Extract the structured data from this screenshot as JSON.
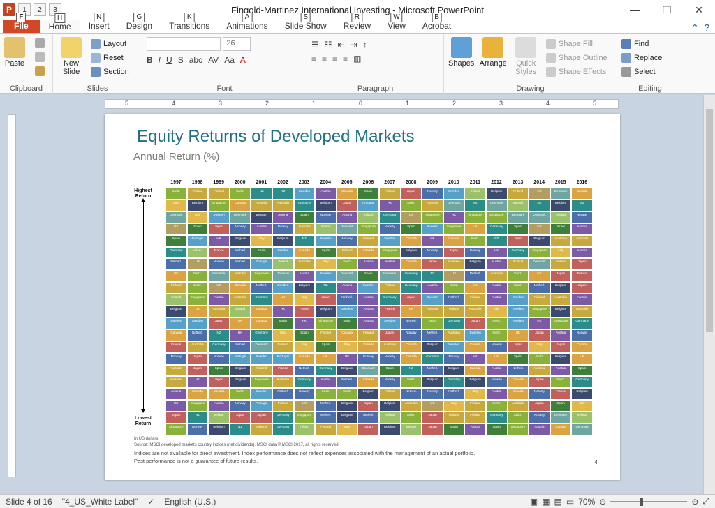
{
  "window": {
    "title": "Fingold-Martinez International Investing  -  Microsoft PowerPoint",
    "app_icon": "P",
    "qat": [
      "1",
      "2",
      "3"
    ]
  },
  "tabs": [
    {
      "label": "File",
      "key": "F"
    },
    {
      "label": "Home",
      "key": "H"
    },
    {
      "label": "Insert",
      "key": "N"
    },
    {
      "label": "Design",
      "key": "G"
    },
    {
      "label": "Transitions",
      "key": "K"
    },
    {
      "label": "Animations",
      "key": "A"
    },
    {
      "label": "Slide Show",
      "key": "S"
    },
    {
      "label": "Review",
      "key": "R"
    },
    {
      "label": "View",
      "key": "W"
    },
    {
      "label": "Acrobat",
      "key": "B"
    }
  ],
  "ribbon": {
    "clipboard": {
      "label": "Clipboard",
      "paste": "Paste"
    },
    "slides": {
      "label": "Slides",
      "new_slide": "New Slide",
      "layout": "Layout",
      "reset": "Reset",
      "section": "Section"
    },
    "font": {
      "label": "Font",
      "size": "26"
    },
    "paragraph": {
      "label": "Paragraph"
    },
    "drawing": {
      "label": "Drawing",
      "shapes": "Shapes",
      "arrange": "Arrange",
      "quick_styles": "Quick Styles",
      "shape_fill": "Shape Fill",
      "shape_outline": "Shape Outline",
      "shape_effects": "Shape Effects"
    },
    "editing": {
      "label": "Editing",
      "find": "Find",
      "replace": "Replace",
      "select": "Select"
    }
  },
  "ruler_labels": [
    "5",
    "4",
    "3",
    "2",
    "1",
    "0",
    "1",
    "2",
    "3",
    "4",
    "5"
  ],
  "slide": {
    "title": "Equity Returns of Developed Markets",
    "subtitle": "Annual Return (%)",
    "highest": "Highest Return",
    "lowest": "Lowest Return",
    "years": [
      "1997",
      "1998",
      "1999",
      "2000",
      "2001",
      "2002",
      "2003",
      "2004",
      "2005",
      "2006",
      "2007",
      "2008",
      "2009",
      "2010",
      "2011",
      "2012",
      "2013",
      "2014",
      "2015",
      "2016"
    ],
    "foot1": "In US dollars.",
    "foot2": "Source: MSCI developed markets country indices (net dividends). MSCI data © MSCI 2017, all rights reserved.",
    "foot3": "Indices are not available for direct investment. Index performance does not reflect expenses associated with the management of an actual portfolio.",
    "foot4": "Past performance is not a guarantee of future results.",
    "page": "4",
    "grid_rows": [
      [
        "Switz.",
        "Finland",
        "Finland",
        "Switz.",
        "NZ",
        "NZ",
        "Sweden",
        "Austria",
        "Canada",
        "Spain",
        "Finland",
        "Japan",
        "Norway",
        "Sweden",
        "Ireland",
        "Belgium",
        "Finland",
        "US",
        "Denmark",
        "Canada"
      ],
      [
        "Italy",
        "Belgium",
        "Singapore",
        "Canada",
        "Australia",
        "Australia",
        "Germany",
        "Belgium",
        "Japan",
        "Portugal",
        "HK",
        "Switz.",
        "Australia",
        "Denmark",
        "NZ",
        "Denmark",
        "Ireland",
        "NZ",
        "Belgium",
        "NZ"
      ],
      [
        "Denmark",
        "Italy",
        "Sweden",
        "Denmark",
        "Belgium",
        "Austria",
        "Spain",
        "Norway",
        "Austria",
        "Ireland",
        "Germany",
        "US",
        "Singapore",
        "HK",
        "Singapore",
        "Singapore",
        "Denmark",
        "Denmark",
        "Ireland",
        "Norway"
      ],
      [
        "US",
        "Spain",
        "Japan",
        "Norway",
        "Austria",
        "Norway",
        "Australia",
        "Ireland",
        "Denmark",
        "Singapore",
        "Norway",
        "Spain",
        "Sweden",
        "Singapore",
        "UK",
        "Germany",
        "Spain",
        "US",
        "Israel",
        "Austria"
      ],
      [
        "Spain",
        "Portugal",
        "HK",
        "Belgium",
        "Italy",
        "Belgium",
        "NZ",
        "Sweden",
        "Norway",
        "Finland",
        "Sweden",
        "Canada",
        "HK",
        "Canada",
        "Switz.",
        "NZ",
        "Japan",
        "Belgium",
        "Australia",
        "Australia"
      ],
      [
        "Germany",
        "Ireland",
        "France",
        "Netherl.",
        "Spain",
        "Sweden",
        "Canada",
        "Spain",
        "Finland",
        "Canada",
        "Singapore",
        "Belgium",
        "Norway",
        "Japan",
        "Norway",
        "HK",
        "Germany",
        "Singapore",
        "Italy",
        "Austria"
      ],
      [
        "Netherl.",
        "US",
        "Norway",
        "Netherl.",
        "Portugal",
        "Ireland",
        "Australia",
        "Italy",
        "Switz.",
        "Austria",
        "Austria",
        "Canada",
        "Japan",
        "Australia",
        "Belgium",
        "Austria",
        "Finland",
        "Denmark",
        "Finland",
        "Japan"
      ],
      [
        "UK",
        "Switz.",
        "Denmark",
        "Australia",
        "Singapore",
        "Denmark",
        "Austria",
        "Sweden",
        "Denmark",
        "Spain",
        "Denmark",
        "Germany",
        "NZ",
        "US",
        "Netherl.",
        "Australia",
        "Switz.",
        "UK",
        "Japan",
        "France"
      ],
      [
        "Finland",
        "Switz.",
        "US",
        "Canada",
        "Netherl.",
        "Sweden",
        "Belgium",
        "NZ",
        "Austria",
        "Sweden",
        "Finland",
        "Germany",
        "Austria",
        "Switz.",
        "UK",
        "Austria",
        "Switz.",
        "Netherl.",
        "Belgium",
        "Japan"
      ],
      [
        "Ireland",
        "Singapore",
        "Austria",
        "Australia",
        "Germany",
        "UK",
        "Italy",
        "Japan",
        "Netherl.",
        "Austria",
        "Germany",
        "Japan",
        "Sweden",
        "Netherl.",
        "Finland",
        "Austria",
        "Sweden",
        "Finland",
        "Australia",
        "Austria"
      ],
      [
        "Belgium",
        "UK",
        "Australia",
        "Ireland",
        "Canada",
        "HK",
        "France",
        "Belgium",
        "Sweden",
        "Austria",
        "France",
        "UK",
        "Australia",
        "Finland",
        "Australia",
        "Italy",
        "Sweden",
        "Singapore",
        "Belgium",
        "Australia"
      ],
      [
        "Sweden",
        "Sweden",
        "Japan",
        "UK",
        "Canada",
        "Spain",
        "HK",
        "Singapore",
        "Spain",
        "Austria",
        "Sweden",
        "Netherl.",
        "Switz.",
        "Germany",
        "Japan",
        "Switz.",
        "Sweden",
        "HK",
        "Singapore",
        "Germany"
      ],
      [
        "Canada",
        "Netherl.",
        "NZ",
        "HK",
        "Germany",
        "Italy",
        "Spain",
        "Finland",
        "Canada",
        "Finland",
        "Japan",
        "Norway",
        "Netherl.",
        "Australia",
        "Sweden",
        "Switz.",
        "UK",
        "Japan",
        "Austria",
        "Norway"
      ],
      [
        "France",
        "Australia",
        "Germany",
        "Netherl.",
        "Denmark",
        "Finland",
        "Italy",
        "Spain",
        "Italy",
        "Canada",
        "Australia",
        "Canada",
        "Belgium",
        "Sweden",
        "Canada",
        "Norway",
        "Japan",
        "Italy",
        "Japan",
        "Canada"
      ],
      [
        "Norway",
        "Japan",
        "Norway",
        "Portugal",
        "Sweden",
        "Portugal",
        "Canada",
        "UK",
        "HK",
        "Norway",
        "Norway",
        "Canada",
        "Germany",
        "Norway",
        "HK",
        "UK",
        "Spain",
        "Switz.",
        "Belgium",
        "UK"
      ],
      [
        "Australia",
        "Japan",
        "Spain",
        "Belgium",
        "Finland",
        "France",
        "Netherl.",
        "Germany",
        "Belgium",
        "Denmark",
        "Spain",
        "NZ",
        "Netherl.",
        "Belgium",
        "Canada",
        "Austria",
        "Netherl.",
        "Australia",
        "Austria",
        "Spain"
      ],
      [
        "Australia",
        "HK",
        "Japan",
        "Belgium",
        "Singapore",
        "Australia",
        "Germany",
        "Austria",
        "Netherl.",
        "Canada",
        "Norway",
        "Switz.",
        "Belgium",
        "Germany",
        "Belgium",
        "Norway",
        "Canada",
        "Japan",
        "Switz.",
        "Germany"
      ],
      [
        "Austria",
        "Canada",
        "Canada",
        "Switz.",
        "Sweden",
        "Netherl.",
        "Norway",
        "Switz.",
        "Switz.",
        "Belgium",
        "Finland",
        "Netherl.",
        "Norway",
        "Netherl.",
        "Italy",
        "Austria",
        "Canada",
        "Norway",
        "France",
        "Belgium"
      ],
      [
        "HK",
        "Singapore",
        "Austria",
        "Norway",
        "Portugal",
        "Finland",
        "US",
        "Netherl.",
        "Belgium",
        "Japan",
        "Belgium",
        "Australia",
        "US",
        "Italy",
        "Finland",
        "Switz.",
        "Australia",
        "Japan",
        "Spain",
        "Italy"
      ],
      [
        "Japan",
        "NZ",
        "Ireland",
        "Japan",
        "Japan",
        "Germany",
        "Singapore",
        "Netherl.",
        "Belgium",
        "Netherl.",
        "Ireland",
        "Switz.",
        "Japan",
        "Finland",
        "Finland",
        "Germany",
        "Switz.",
        "Norway",
        "Denmark",
        "Ireland"
      ],
      [
        "Singapore",
        "Norway",
        "Belgium",
        "NZ",
        "Finland",
        "Germany",
        "Ireland",
        "Finland",
        "Italy",
        "Japan",
        "Belgium",
        "Ireland",
        "Japan",
        "Spain",
        "Austria",
        "Spain",
        "Singapore",
        "Austria",
        "Canada",
        "Denmark"
      ]
    ],
    "colors": [
      "#8ab13a",
      "#c8a93e",
      "#2c8c8a",
      "#57a1c9",
      "#7c5aa5",
      "#d9a441",
      "#3f7f3b",
      "#c0615e",
      "#4d6fa9",
      "#9bc26a",
      "#3c4a6e",
      "#b39d61",
      "#6fa6a1",
      "#e0b94a"
    ]
  },
  "status": {
    "slide": "Slide 4 of 16",
    "theme": "\"4_US_White Label\"",
    "language": "English (U.S.)",
    "zoom": "70%"
  }
}
